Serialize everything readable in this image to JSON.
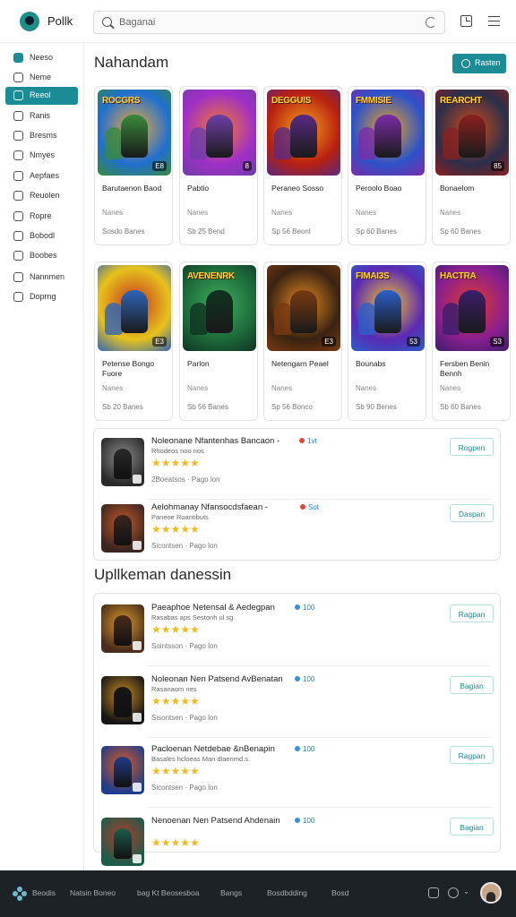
{
  "app": {
    "title": "Pollk",
    "search_placeholder": "Baganai"
  },
  "sidebar": {
    "items": [
      {
        "label": "Neeso",
        "icon": "home-icon"
      },
      {
        "label": "Neme",
        "icon": "grid-icon"
      },
      {
        "label": "Reeol",
        "icon": "store-icon"
      },
      {
        "label": "Ranis",
        "icon": "book-icon"
      },
      {
        "label": "Bresms",
        "icon": "clock-icon"
      },
      {
        "label": "Nmyes",
        "icon": "tag-icon"
      },
      {
        "label": "Aepfaes",
        "icon": "shield-icon"
      },
      {
        "label": "Reuolen",
        "icon": "person-icon"
      },
      {
        "label": "Ropre",
        "icon": "gear-icon"
      },
      {
        "label": "Bobodl",
        "icon": "refresh-icon"
      },
      {
        "label": "Boobes",
        "icon": "archive-icon"
      },
      {
        "label": "Nannmen",
        "icon": "mail-icon"
      },
      {
        "label": "Doprng",
        "icon": "document-icon"
      }
    ]
  },
  "featured": {
    "title": "Nahandam",
    "action_label": "Rasten",
    "row1": [
      {
        "banner": "ROCGRS",
        "title": "Barutaenon Baod",
        "sub": "Nanes",
        "footer": "Sosdo Banes",
        "badge": "E8",
        "colors": [
          "#1f6fd1",
          "#f2a93b",
          "#3a8a3c"
        ]
      },
      {
        "banner": "",
        "title": "Pabtio",
        "sub": "Nanes",
        "footer": "Sb 25 Bend",
        "badge": "8",
        "colors": [
          "#a02fc7",
          "#f57c2a",
          "#6e3fa8"
        ]
      },
      {
        "banner": "DEGGUIS",
        "title": "Peraneo Sosso",
        "sub": "Nanes",
        "footer": "Sp 56 Beonl",
        "badge": "",
        "colors": [
          "#b8200f",
          "#f4a11d",
          "#5a2a82"
        ]
      },
      {
        "banner": "FMMISIE",
        "title": "Peroolo Boao",
        "sub": "Nanes",
        "footer": "Sp 60 Banes",
        "badge": "",
        "colors": [
          "#2d53c9",
          "#e9a223",
          "#7b2ca7"
        ]
      },
      {
        "banner": "REARCHT",
        "title": "Bonaelom",
        "sub": "Nanes",
        "footer": "Sp 60 Banes",
        "badge": "85",
        "colors": [
          "#2b2f4a",
          "#d14a1a",
          "#8a2020"
        ]
      }
    ],
    "row2": [
      {
        "banner": "",
        "title": "Petense Bongo Fuore",
        "sub": "Nanes",
        "footer": "Sb 20 Banes",
        "badge": "E3",
        "colors": [
          "#e7c21c",
          "#c4341e",
          "#2e64b8"
        ]
      },
      {
        "banner": "AVENENRK",
        "title": "Parlon",
        "sub": "Nanes",
        "footer": "Sb 56 Banes",
        "badge": "",
        "colors": [
          "#1d6a3a",
          "#3fae5d",
          "#0f3320"
        ]
      },
      {
        "banner": "",
        "title": "Netengarn Peael",
        "sub": "Nanes",
        "footer": "Sp 56 Bonco",
        "badge": "E3",
        "colors": [
          "#3a2312",
          "#e58a1f",
          "#7a3a12"
        ]
      },
      {
        "banner": "FIMAI3S",
        "title": "Bounabs",
        "sub": "Nanes",
        "footer": "Sb 90 Benes",
        "badge": "53",
        "colors": [
          "#5a2ab3",
          "#f1c232",
          "#2b5fc9"
        ]
      },
      {
        "banner": "HACTRA",
        "title": "Fersben Benin Bennh",
        "sub": "Nanes",
        "footer": "Sb 60 Banes",
        "badge": "S3",
        "colors": [
          "#8a1f8f",
          "#e0392b",
          "#3b1e6b"
        ]
      }
    ]
  },
  "panel1": {
    "rows": [
      {
        "name": "Noleonane Nfantenhas Bancaon -",
        "tag": "1vt",
        "tag_color": "#e0453a",
        "sub": "Rhodeos noo nos",
        "stars": "★★★★★",
        "meta": "2Boeatsos  ·  Pago lon",
        "action": "Rogpen",
        "colors": [
          "#2a2a2a",
          "#8a8a8a"
        ]
      },
      {
        "name": "Aelohmanay Nfansocdsfaean -",
        "tag": "Sot",
        "tag_color": "#e0453a",
        "sub": "Paneoe Roantibuts",
        "stars": "★★★★★",
        "meta": "Sicontsen  ·  Pago lon",
        "action": "Daspan",
        "colors": [
          "#3a2520",
          "#c65a25"
        ]
      }
    ]
  },
  "updates": {
    "title": "Upllkeman danessin",
    "rows": [
      {
        "name": "Paeaphoe Netensal & Aedegpan",
        "tag": "100",
        "tag_color": "#3a8fd6",
        "sub": "Rasabas aps Sestonh ul sg",
        "stars": "★★★★★",
        "meta": "Sointsson  ·  Pago lon",
        "action": "Ragpan",
        "colors": [
          "#4a2c1a",
          "#d99a2b"
        ]
      },
      {
        "name": "Noleonan Nen Patsend AvBenatan",
        "tag": "100",
        "tag_color": "#3a8fd6",
        "sub": "Rasanaom nes",
        "stars": "★★★★★",
        "meta": "Sisontsen  ·  Pago lon",
        "action": "Bagian",
        "colors": [
          "#161616",
          "#c98a1e"
        ]
      },
      {
        "name": "Pacloenan Netdebae &nBenapin",
        "tag": "100",
        "tag_color": "#3a8fd6",
        "sub": "Basales hcloeas Man dlaenmd.s.",
        "stars": "★★★★★",
        "meta": "Sicontsen  ·  Pago lon",
        "action": "Ragpan",
        "colors": [
          "#1f3d8a",
          "#e25a1a"
        ]
      },
      {
        "name": "Nenoenan Nen Patsend Ahdenain",
        "tag": "100",
        "tag_color": "#3a8fd6",
        "sub": "",
        "stars": "★★★★★",
        "meta": "",
        "action": "Bagian",
        "colors": [
          "#1d5c4a",
          "#b53a2a"
        ]
      }
    ]
  },
  "bottombar": {
    "items": [
      "Beodis",
      "Natsin Boneo",
      "bag Kt Beosesboa",
      "Bangs",
      "Bosdbdding",
      "Bosd"
    ],
    "icons": [
      "home-icon",
      "gear-icon"
    ]
  }
}
